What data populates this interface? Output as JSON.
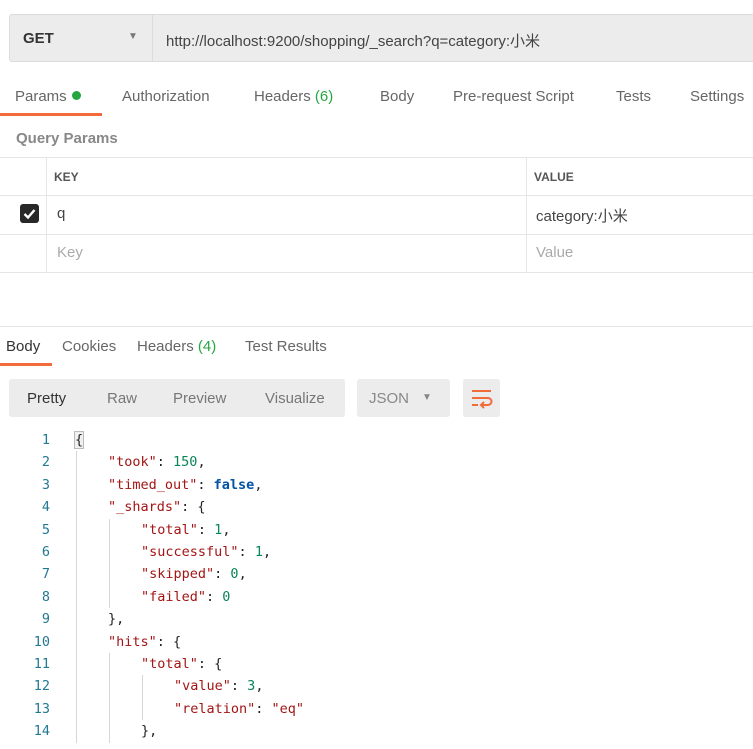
{
  "request": {
    "method": "GET",
    "url": "http://localhost:9200/shopping/_search?q=category:小米"
  },
  "request_tabs": [
    {
      "label": "Params",
      "active": true,
      "indicator": "green-dot"
    },
    {
      "label": "Authorization"
    },
    {
      "label": "Headers",
      "count": "(6)"
    },
    {
      "label": "Body"
    },
    {
      "label": "Pre-request Script"
    },
    {
      "label": "Tests"
    },
    {
      "label": "Settings"
    }
  ],
  "query_params": {
    "title": "Query Params",
    "columns": [
      "KEY",
      "VALUE"
    ],
    "rows": [
      {
        "checked": true,
        "key": "q",
        "value": "category:小米"
      }
    ],
    "placeholder": {
      "key": "Key",
      "value": "Value"
    }
  },
  "response_tabs": [
    {
      "label": "Body",
      "active": true
    },
    {
      "label": "Cookies"
    },
    {
      "label": "Headers",
      "count": "(4)"
    },
    {
      "label": "Test Results"
    }
  ],
  "view_modes": [
    "Pretty",
    "Raw",
    "Preview",
    "Visualize"
  ],
  "active_view": "Pretty",
  "format": "JSON",
  "wrap_icon": "wrap-lines-icon",
  "colors": {
    "accent": "#f26b3a",
    "green": "#26a641",
    "key": "#a31515",
    "number": "#098658",
    "boolean": "#0451a5"
  },
  "code_lines": [
    {
      "n": "1",
      "indent": 0,
      "tokens": [
        [
          "p",
          "{"
        ]
      ]
    },
    {
      "n": "2",
      "indent": 1,
      "tokens": [
        [
          "k",
          "\"took\""
        ],
        [
          "p",
          ": "
        ],
        [
          "n",
          "150"
        ],
        [
          "p",
          ","
        ]
      ]
    },
    {
      "n": "3",
      "indent": 1,
      "tokens": [
        [
          "k",
          "\"timed_out\""
        ],
        [
          "p",
          ": "
        ],
        [
          "b",
          "false"
        ],
        [
          "p",
          ","
        ]
      ]
    },
    {
      "n": "4",
      "indent": 1,
      "tokens": [
        [
          "k",
          "\"_shards\""
        ],
        [
          "p",
          ": {"
        ]
      ]
    },
    {
      "n": "5",
      "indent": 2,
      "tokens": [
        [
          "k",
          "\"total\""
        ],
        [
          "p",
          ": "
        ],
        [
          "n",
          "1"
        ],
        [
          "p",
          ","
        ]
      ]
    },
    {
      "n": "6",
      "indent": 2,
      "tokens": [
        [
          "k",
          "\"successful\""
        ],
        [
          "p",
          ": "
        ],
        [
          "n",
          "1"
        ],
        [
          "p",
          ","
        ]
      ]
    },
    {
      "n": "7",
      "indent": 2,
      "tokens": [
        [
          "k",
          "\"skipped\""
        ],
        [
          "p",
          ": "
        ],
        [
          "n",
          "0"
        ],
        [
          "p",
          ","
        ]
      ]
    },
    {
      "n": "8",
      "indent": 2,
      "tokens": [
        [
          "k",
          "\"failed\""
        ],
        [
          "p",
          ": "
        ],
        [
          "n",
          "0"
        ]
      ]
    },
    {
      "n": "9",
      "indent": 1,
      "tokens": [
        [
          "p",
          "},"
        ]
      ]
    },
    {
      "n": "10",
      "indent": 1,
      "tokens": [
        [
          "k",
          "\"hits\""
        ],
        [
          "p",
          ": {"
        ]
      ]
    },
    {
      "n": "11",
      "indent": 2,
      "tokens": [
        [
          "k",
          "\"total\""
        ],
        [
          "p",
          ": {"
        ]
      ]
    },
    {
      "n": "12",
      "indent": 3,
      "tokens": [
        [
          "k",
          "\"value\""
        ],
        [
          "p",
          ": "
        ],
        [
          "n",
          "3"
        ],
        [
          "p",
          ","
        ]
      ]
    },
    {
      "n": "13",
      "indent": 3,
      "tokens": [
        [
          "k",
          "\"relation\""
        ],
        [
          "p",
          ": "
        ],
        [
          "k",
          "\"eq\""
        ]
      ]
    },
    {
      "n": "14",
      "indent": 2,
      "tokens": [
        [
          "p",
          "},"
        ]
      ]
    }
  ]
}
